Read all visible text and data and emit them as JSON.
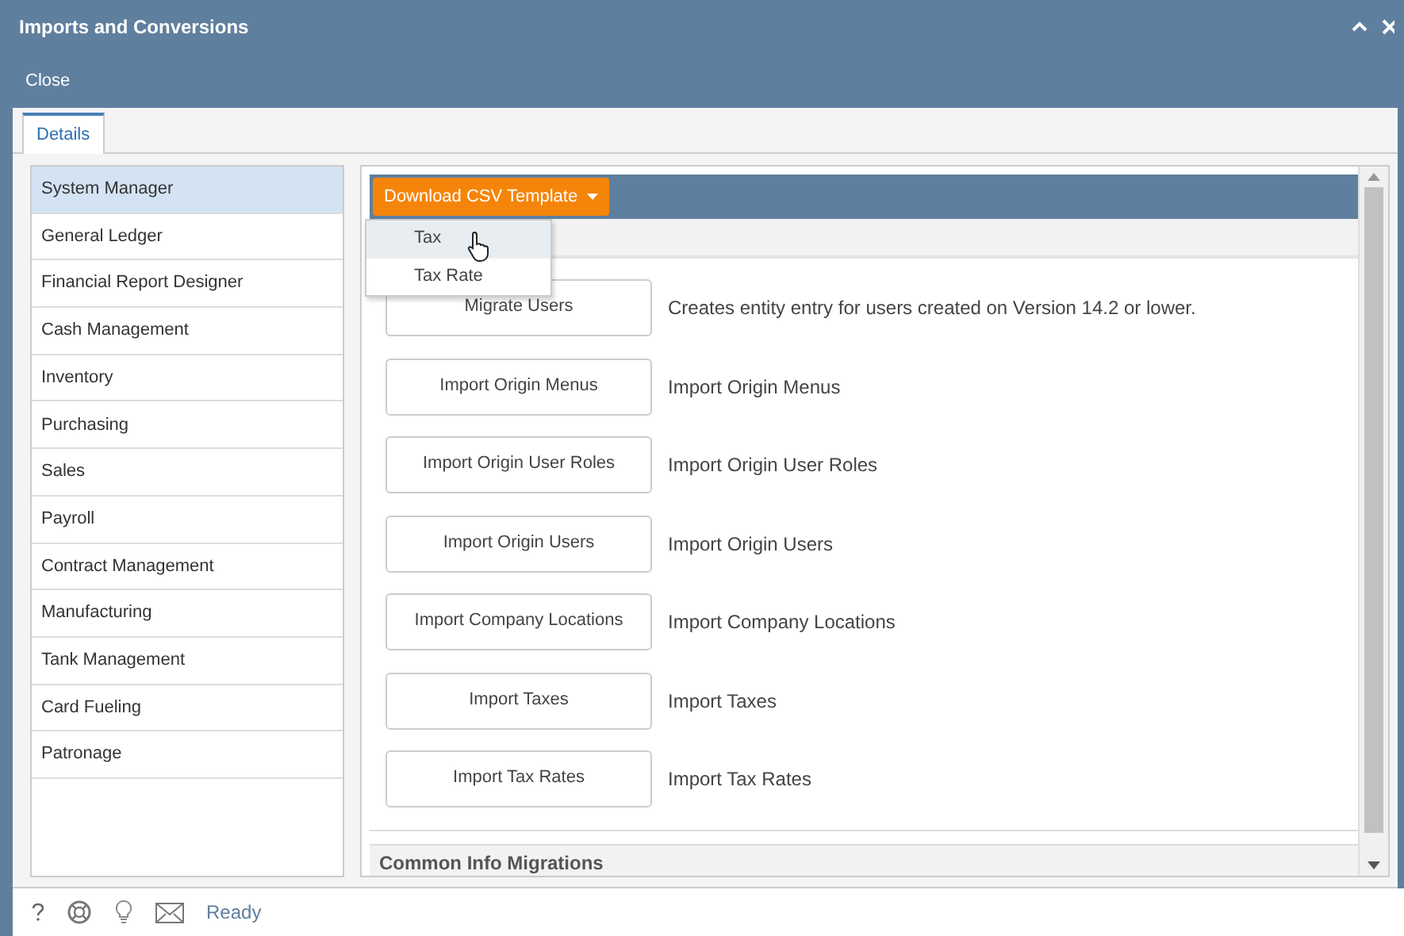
{
  "window": {
    "title": "Imports and Conversions"
  },
  "toolbar": {
    "buttons": [
      "Close"
    ]
  },
  "tabs": [
    {
      "label": "Details",
      "selected": true
    }
  ],
  "sidebar": {
    "items": [
      {
        "label": "System Manager",
        "selected": true
      },
      {
        "label": "General Ledger",
        "selected": false
      },
      {
        "label": "Financial Report Designer",
        "selected": false
      },
      {
        "label": "Cash Management",
        "selected": false
      },
      {
        "label": "Inventory",
        "selected": false
      },
      {
        "label": "Purchasing",
        "selected": false
      },
      {
        "label": "Sales",
        "selected": false
      },
      {
        "label": "Payroll",
        "selected": false
      },
      {
        "label": "Contract Management",
        "selected": false
      },
      {
        "label": "Manufacturing",
        "selected": false
      },
      {
        "label": "Tank Management",
        "selected": false
      },
      {
        "label": "Card Fueling",
        "selected": false
      },
      {
        "label": "Patronage",
        "selected": false
      }
    ]
  },
  "main": {
    "download_button": {
      "label": "Download CSV Template",
      "expanded": true
    },
    "dropdown_items": [
      {
        "label": "Tax",
        "selected": true
      },
      {
        "label": "Tax Rate",
        "selected": false
      }
    ],
    "actions": [
      {
        "button": "Migrate Users",
        "description": "Creates entity entry for users created on Version 14.2 or lower."
      },
      {
        "button": "Import Origin Menus",
        "description": "Import Origin Menus"
      },
      {
        "button": "Import Origin User Roles",
        "description": "Import Origin User Roles"
      },
      {
        "button": "Import Origin Users",
        "description": "Import Origin Users"
      },
      {
        "button": "Import Company Locations",
        "description": "Import Company Locations"
      },
      {
        "button": "Import Taxes",
        "description": "Import Taxes"
      },
      {
        "button": "Import Tax Rates",
        "description": "Import Tax Rates"
      }
    ],
    "next_section": {
      "title": "Common Info Migrations"
    }
  },
  "status_bar": {
    "status": "Ready"
  }
}
